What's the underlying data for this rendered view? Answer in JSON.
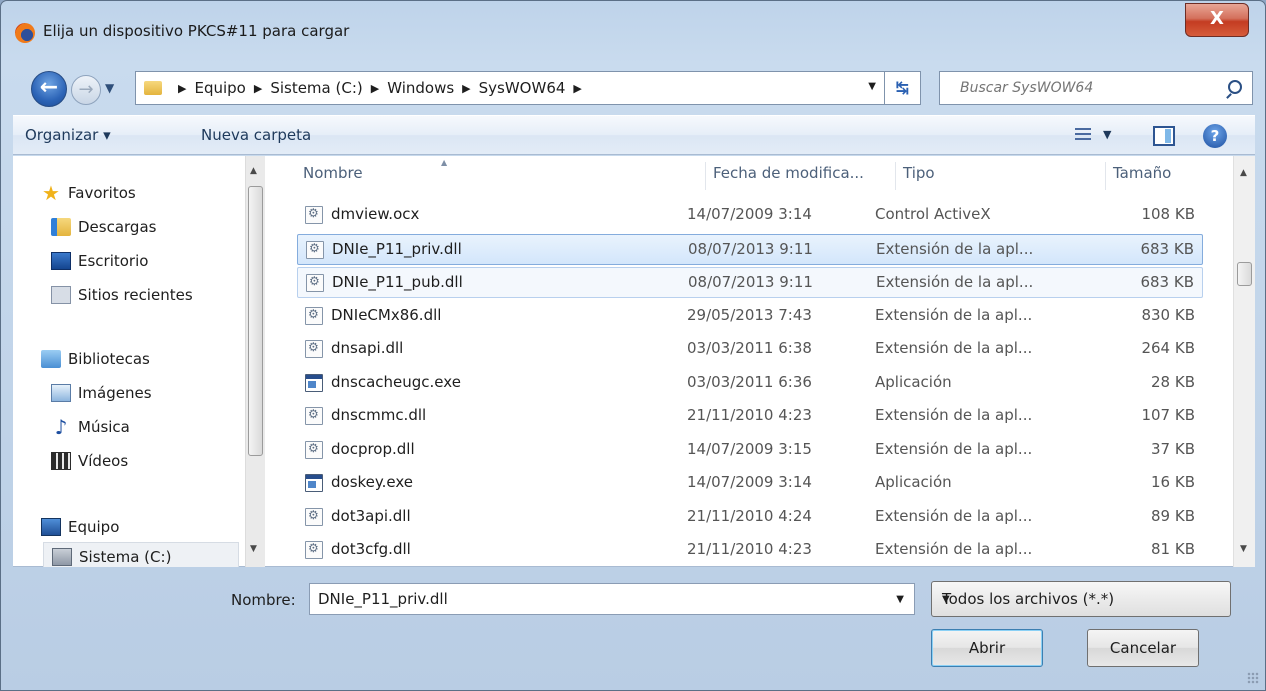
{
  "window": {
    "title": "Elija un dispositivo PKCS#11 para cargar",
    "close_label": "X"
  },
  "address": {
    "crumbs": [
      "Equipo",
      "Sistema (C:)",
      "Windows",
      "SysWOW64"
    ],
    "search_placeholder": "Buscar SysWOW64"
  },
  "toolbar": {
    "organize_label": "Organizar ▾",
    "new_folder_label": "Nueva carpeta",
    "help_label": "?"
  },
  "nav": {
    "favorites": "Favoritos",
    "downloads": "Descargas",
    "desktop": "Escritorio",
    "recent": "Sitios recientes",
    "libraries": "Bibliotecas",
    "images": "Imágenes",
    "music": "Música",
    "videos": "Vídeos",
    "computer": "Equipo",
    "system_drive": "Sistema (C:)"
  },
  "columns": {
    "name": "Nombre",
    "date": "Fecha de modifica...",
    "type": "Tipo",
    "size": "Tamaño"
  },
  "files": [
    {
      "name": "dmview.ocx",
      "date": "14/07/2009 3:14",
      "type": "Control ActiveX",
      "size": "108 KB",
      "icon": "dll-icon"
    },
    {
      "name": "DNIe_P11_priv.dll",
      "date": "08/07/2013 9:11",
      "type": "Extensión de la apl...",
      "size": "683 KB",
      "icon": "dll-icon"
    },
    {
      "name": "DNIe_P11_pub.dll",
      "date": "08/07/2013 9:11",
      "type": "Extensión de la apl...",
      "size": "683 KB",
      "icon": "dll-icon"
    },
    {
      "name": "DNIeCMx86.dll",
      "date": "29/05/2013 7:43",
      "type": "Extensión de la apl...",
      "size": "830 KB",
      "icon": "dll-icon"
    },
    {
      "name": "dnsapi.dll",
      "date": "03/03/2011 6:38",
      "type": "Extensión de la apl...",
      "size": "264 KB",
      "icon": "dll-icon"
    },
    {
      "name": "dnscacheugc.exe",
      "date": "03/03/2011 6:36",
      "type": "Aplicación",
      "size": "28 KB",
      "icon": "exe-icon"
    },
    {
      "name": "dnscmmc.dll",
      "date": "21/11/2010 4:23",
      "type": "Extensión de la apl...",
      "size": "107 KB",
      "icon": "dll-icon"
    },
    {
      "name": "docprop.dll",
      "date": "14/07/2009 3:15",
      "type": "Extensión de la apl...",
      "size": "37 KB",
      "icon": "dll-icon"
    },
    {
      "name": "doskey.exe",
      "date": "14/07/2009 3:14",
      "type": "Aplicación",
      "size": "16 KB",
      "icon": "exe-icon"
    },
    {
      "name": "dot3api.dll",
      "date": "21/11/2010 4:24",
      "type": "Extensión de la apl...",
      "size": "89 KB",
      "icon": "dll-icon"
    },
    {
      "name": "dot3cfg.dll",
      "date": "21/11/2010 4:23",
      "type": "Extensión de la apl...",
      "size": "81 KB",
      "icon": "dll-icon"
    }
  ],
  "bottom": {
    "filename_label": "Nombre:",
    "filename_value": "DNIe_P11_priv.dll",
    "filter_value": "Todos los archivos (*.*)",
    "open_label": "Abrir",
    "cancel_label": "Cancelar"
  }
}
